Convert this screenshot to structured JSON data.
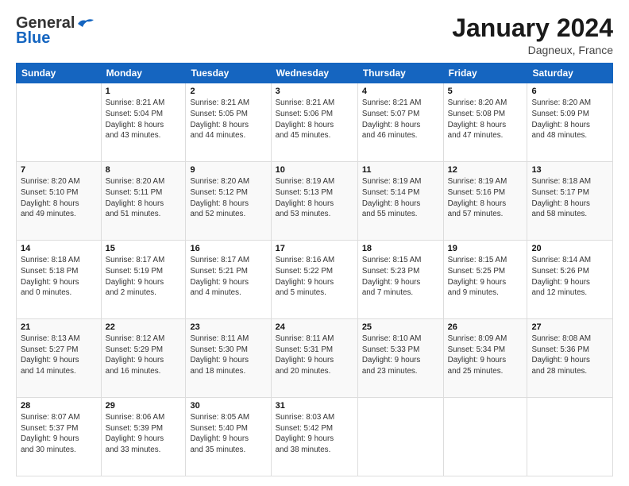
{
  "header": {
    "logo_general": "General",
    "logo_blue": "Blue",
    "title": "January 2024",
    "location": "Dagneux, France"
  },
  "weekdays": [
    "Sunday",
    "Monday",
    "Tuesday",
    "Wednesday",
    "Thursday",
    "Friday",
    "Saturday"
  ],
  "weeks": [
    [
      {
        "day": "",
        "info": ""
      },
      {
        "day": "1",
        "info": "Sunrise: 8:21 AM\nSunset: 5:04 PM\nDaylight: 8 hours\nand 43 minutes."
      },
      {
        "day": "2",
        "info": "Sunrise: 8:21 AM\nSunset: 5:05 PM\nDaylight: 8 hours\nand 44 minutes."
      },
      {
        "day": "3",
        "info": "Sunrise: 8:21 AM\nSunset: 5:06 PM\nDaylight: 8 hours\nand 45 minutes."
      },
      {
        "day": "4",
        "info": "Sunrise: 8:21 AM\nSunset: 5:07 PM\nDaylight: 8 hours\nand 46 minutes."
      },
      {
        "day": "5",
        "info": "Sunrise: 8:20 AM\nSunset: 5:08 PM\nDaylight: 8 hours\nand 47 minutes."
      },
      {
        "day": "6",
        "info": "Sunrise: 8:20 AM\nSunset: 5:09 PM\nDaylight: 8 hours\nand 48 minutes."
      }
    ],
    [
      {
        "day": "7",
        "info": ""
      },
      {
        "day": "8",
        "info": "Sunrise: 8:20 AM\nSunset: 5:11 PM\nDaylight: 8 hours\nand 51 minutes."
      },
      {
        "day": "9",
        "info": "Sunrise: 8:20 AM\nSunset: 5:12 PM\nDaylight: 8 hours\nand 52 minutes."
      },
      {
        "day": "10",
        "info": "Sunrise: 8:19 AM\nSunset: 5:13 PM\nDaylight: 8 hours\nand 53 minutes."
      },
      {
        "day": "11",
        "info": "Sunrise: 8:19 AM\nSunset: 5:14 PM\nDaylight: 8 hours\nand 55 minutes."
      },
      {
        "day": "12",
        "info": "Sunrise: 8:19 AM\nSunset: 5:16 PM\nDaylight: 8 hours\nand 57 minutes."
      },
      {
        "day": "13",
        "info": "Sunrise: 8:18 AM\nSunset: 5:17 PM\nDaylight: 8 hours\nand 58 minutes."
      }
    ],
    [
      {
        "day": "14",
        "info": ""
      },
      {
        "day": "15",
        "info": "Sunrise: 8:17 AM\nSunset: 5:19 PM\nDaylight: 9 hours\nand 2 minutes."
      },
      {
        "day": "16",
        "info": "Sunrise: 8:17 AM\nSunset: 5:21 PM\nDaylight: 9 hours\nand 4 minutes."
      },
      {
        "day": "17",
        "info": "Sunrise: 8:16 AM\nSunset: 5:22 PM\nDaylight: 9 hours\nand 5 minutes."
      },
      {
        "day": "18",
        "info": "Sunrise: 8:15 AM\nSunset: 5:23 PM\nDaylight: 9 hours\nand 7 minutes."
      },
      {
        "day": "19",
        "info": "Sunrise: 8:15 AM\nSunset: 5:25 PM\nDaylight: 9 hours\nand 9 minutes."
      },
      {
        "day": "20",
        "info": "Sunrise: 8:14 AM\nSunset: 5:26 PM\nDaylight: 9 hours\nand 12 minutes."
      }
    ],
    [
      {
        "day": "21",
        "info": ""
      },
      {
        "day": "22",
        "info": "Sunrise: 8:12 AM\nSunset: 5:29 PM\nDaylight: 9 hours\nand 16 minutes."
      },
      {
        "day": "23",
        "info": "Sunrise: 8:11 AM\nSunset: 5:30 PM\nDaylight: 9 hours\nand 18 minutes."
      },
      {
        "day": "24",
        "info": "Sunrise: 8:11 AM\nSunset: 5:31 PM\nDaylight: 9 hours\nand 20 minutes."
      },
      {
        "day": "25",
        "info": "Sunrise: 8:10 AM\nSunset: 5:33 PM\nDaylight: 9 hours\nand 23 minutes."
      },
      {
        "day": "26",
        "info": "Sunrise: 8:09 AM\nSunset: 5:34 PM\nDaylight: 9 hours\nand 25 minutes."
      },
      {
        "day": "27",
        "info": "Sunrise: 8:08 AM\nSunset: 5:36 PM\nDaylight: 9 hours\nand 28 minutes."
      }
    ],
    [
      {
        "day": "28",
        "info": "Sunrise: 8:07 AM\nSunset: 5:37 PM\nDaylight: 9 hours\nand 30 minutes."
      },
      {
        "day": "29",
        "info": "Sunrise: 8:06 AM\nSunset: 5:39 PM\nDaylight: 9 hours\nand 33 minutes."
      },
      {
        "day": "30",
        "info": "Sunrise: 8:05 AM\nSunset: 5:40 PM\nDaylight: 9 hours\nand 35 minutes."
      },
      {
        "day": "31",
        "info": "Sunrise: 8:03 AM\nSunset: 5:42 PM\nDaylight: 9 hours\nand 38 minutes."
      },
      {
        "day": "",
        "info": ""
      },
      {
        "day": "",
        "info": ""
      },
      {
        "day": "",
        "info": ""
      }
    ]
  ],
  "week1_sunday_info": "Sunrise: 8:20 AM\nSunset: 5:10 PM\nDaylight: 8 hours\nand 49 minutes.",
  "week2_sunday_info": "Sunrise: 8:18 AM\nSunset: 5:18 PM\nDaylight: 9 hours\nand 0 minutes.",
  "week3_sunday_info": "Sunrise: 8:13 AM\nSunset: 5:27 PM\nDaylight: 9 hours\nand 14 minutes."
}
